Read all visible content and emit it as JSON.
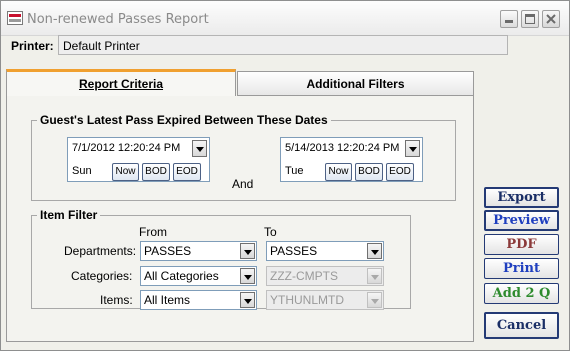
{
  "window": {
    "title": "Non-renewed Passes Report",
    "app_icon": "report-icon"
  },
  "printer": {
    "label": "Printer:",
    "value": "Default Printer"
  },
  "tabs": [
    {
      "label": "Report Criteria",
      "active": true
    },
    {
      "label": "Additional Filters",
      "active": false
    }
  ],
  "date_group": {
    "title": "Guest's Latest Pass Expired Between These Dates",
    "from": {
      "value": "7/1/2012 12:20:24 PM",
      "day": "Sun"
    },
    "and_label": "And",
    "to": {
      "value": "5/14/2013 12:20:24 PM",
      "day": "Tue"
    },
    "buttons": {
      "now": "Now",
      "bod": "BOD",
      "eod": "EOD"
    }
  },
  "item_filter": {
    "title": "Item Filter",
    "from_header": "From",
    "to_header": "To",
    "rows": [
      {
        "label": "Departments:",
        "from": "PASSES",
        "to": "PASSES",
        "to_enabled": true
      },
      {
        "label": "Categories:",
        "from": "All Categories",
        "to": "ZZZ-CMPTS",
        "to_enabled": false
      },
      {
        "label": "Items:",
        "from": "All Items",
        "to": "YTHUNLMTD",
        "to_enabled": false
      }
    ]
  },
  "actions": [
    {
      "label": "Export",
      "color": "#1a2e66"
    },
    {
      "label": "Preview",
      "color": "#1f3fbf"
    },
    {
      "label": "PDF",
      "color": "#8b3a3a"
    },
    {
      "label": "Print",
      "color": "#1f3fbf"
    },
    {
      "label": "Add 2 Q",
      "color": "#2e8b2e"
    },
    {
      "label": "Cancel",
      "color": "#1a2e66"
    }
  ]
}
